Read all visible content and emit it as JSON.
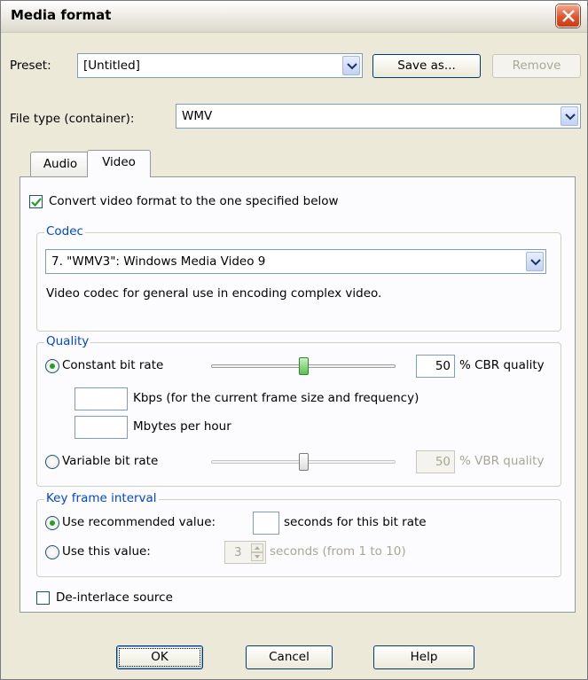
{
  "window": {
    "title": "Media format"
  },
  "preset": {
    "label": "Preset:",
    "value": "[Untitled]",
    "save_as_label": "Save as...",
    "remove_label": "Remove"
  },
  "file_type": {
    "label": "File type (container):",
    "value": "WMV"
  },
  "tabs": [
    {
      "label": "Audio"
    },
    {
      "label": "Video"
    }
  ],
  "video": {
    "convert_label": "Convert video format to the one specified below",
    "convert_checked": true,
    "codec": {
      "group_label": "Codec",
      "value": "7. \"WMV3\": Windows Media Video 9",
      "description": "Video codec for general use in encoding complex video."
    },
    "quality": {
      "group_label": "Quality",
      "constant_label": "Constant bit rate",
      "cbr_value": "50",
      "cbr_suffix": "% CBR quality",
      "kbps_value": "",
      "kbps_label": "Kbps (for the current frame size and frequency)",
      "mbytes_value": "",
      "mbytes_label": "Mbytes per hour",
      "variable_label": "Variable bit rate",
      "vbr_value": "50",
      "vbr_suffix": "% VBR quality",
      "selected": "constant",
      "cbr_slider_level": 0.5,
      "vbr_slider_level": 0.5
    },
    "keyframe": {
      "group_label": "Key frame interval",
      "recommended_label": "Use recommended value:",
      "recommended_value": "",
      "recommended_suffix": "seconds for this bit rate",
      "this_value_label": "Use this value:",
      "this_value": "3",
      "this_value_suffix": "seconds (from 1 to 10)",
      "selected": "recommended"
    },
    "deinterlace_label": "De-interlace source",
    "deinterlace_checked": false
  },
  "footer": {
    "ok_label": "OK",
    "cancel_label": "Cancel",
    "help_label": "Help"
  },
  "colors": {
    "group_label": "#0046d5",
    "radio_dot": "#21a121",
    "close_button": "#e0542d"
  }
}
